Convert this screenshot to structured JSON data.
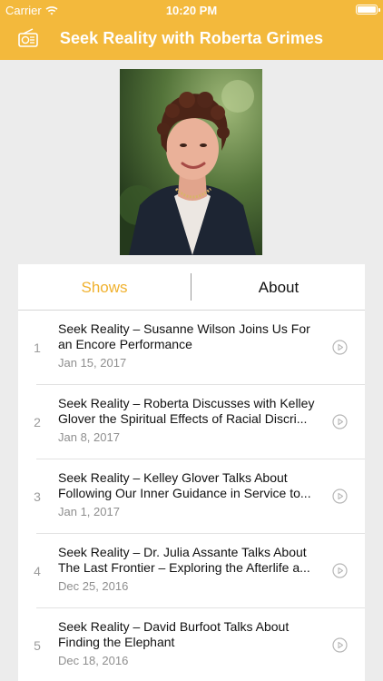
{
  "status_bar": {
    "carrier": "Carrier",
    "time": "10:20 PM"
  },
  "nav": {
    "title": "Seek Reality with Roberta Grimes",
    "icon": "radio-icon"
  },
  "tabs": [
    {
      "label": "Shows",
      "active": true
    },
    {
      "label": "About",
      "active": false
    }
  ],
  "colors": {
    "accent": "#F3B93C",
    "active_tab": "#F0B12E"
  },
  "episodes": [
    {
      "number": "1",
      "title_line1": "Seek Reality – Susanne Wilson Joins Us For",
      "title_line2": "an Encore Performance",
      "date": "Jan 15, 2017"
    },
    {
      "number": "2",
      "title_line1": "Seek Reality – Roberta Discusses with Kelley",
      "title_line2": "Glover the Spiritual Effects of Racial Discri...",
      "date": "Jan 8, 2017"
    },
    {
      "number": "3",
      "title_line1": "Seek Reality – Kelley Glover Talks About",
      "title_line2": "Following Our Inner Guidance in Service to...",
      "date": "Jan 1, 2017"
    },
    {
      "number": "4",
      "title_line1": "Seek Reality – Dr. Julia Assante Talks About",
      "title_line2": "The Last Frontier – Exploring the Afterlife a...",
      "date": "Dec 25, 2016"
    },
    {
      "number": "5",
      "title_line1": "Seek Reality – David Burfoot Talks About",
      "title_line2": "Finding the Elephant",
      "date": "Dec 18, 2016"
    }
  ]
}
